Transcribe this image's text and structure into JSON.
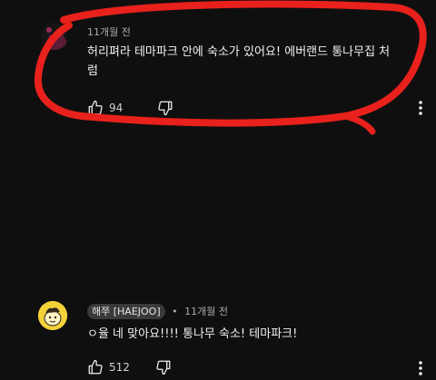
{
  "comments": [
    {
      "author": "",
      "time": "11개월 전",
      "text": "허리펴라 테마파크 안에 숙소가 있어요! 에버랜드 통나무집 처럼",
      "likes": "94"
    },
    {
      "author": "해쭈 [HAEJOO]",
      "time": "11개월 전",
      "text": "ㅇ율 네 맞아요!!!! 통나무 숙소! 테마파크!",
      "likes": "512"
    }
  ],
  "icons": {
    "like": "thumbs-up-icon",
    "dislike": "thumbs-down-icon",
    "more": "more-vertical-icon"
  },
  "colors": {
    "background": "#0f0f0f",
    "annotation": "#e8211c",
    "avatar_yellow": "#f5d23a"
  }
}
